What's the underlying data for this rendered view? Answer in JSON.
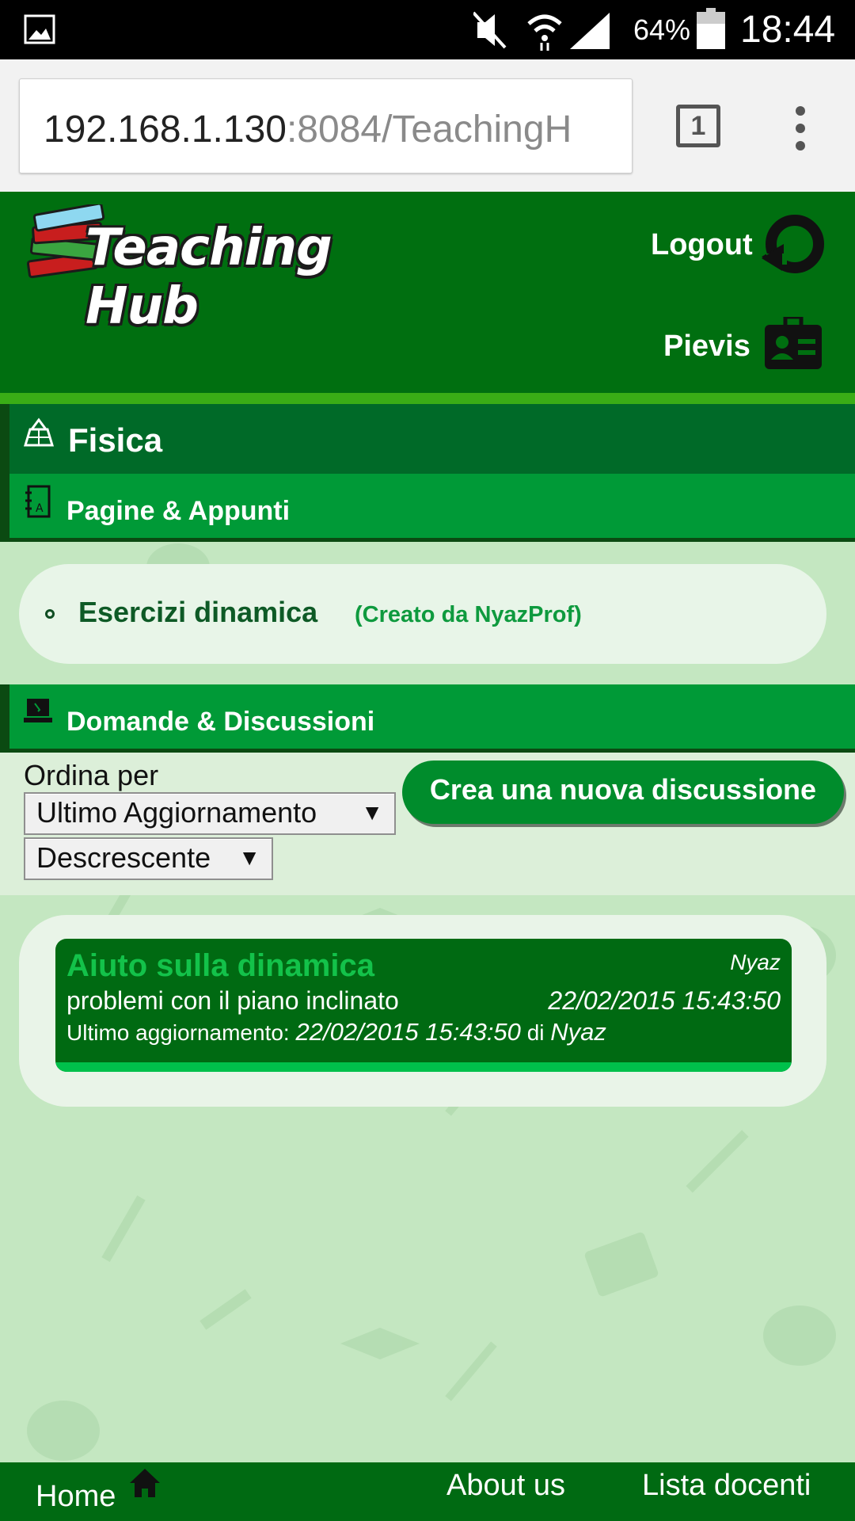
{
  "status_bar": {
    "battery_percent": "64%",
    "time": "18:44"
  },
  "browser": {
    "url_host": "192.168.1.130",
    "url_rest": ":8084/TeachingH",
    "tab_count": "1"
  },
  "header": {
    "logo_text": "Teaching Hub",
    "logout_label": "Logout",
    "user_name": "Pievis"
  },
  "subject": {
    "title": "Fisica"
  },
  "pages": {
    "section_title": "Pagine & Appunti",
    "items": [
      {
        "name": "Esercizi dinamica",
        "creator": "(Creato da NyazProf)"
      }
    ]
  },
  "discussions": {
    "section_title": "Domande & Discussioni",
    "sort_label": "Ordina per",
    "sort_field": "Ultimo Aggiornamento",
    "sort_order": "Descrescente",
    "create_button": "Crea una nuova discussione",
    "items": [
      {
        "title": "Aiuto sulla dinamica",
        "author": "Nyaz",
        "subtitle": "problemi con il piano inclinato",
        "created": "22/02/2015 15:43:50",
        "updated_label": "Ultimo aggiornamento:",
        "updated_date": "22/02/2015 15:43:50",
        "by_label": "di",
        "updated_by": "Nyaz"
      }
    ]
  },
  "footer": {
    "home": "Home",
    "about": "About us",
    "docenti": "Lista docenti"
  },
  "colors": {
    "header_green": "#006f10",
    "section_green": "#009a37",
    "subject_green": "#006a28",
    "background": "#c4e7c1",
    "accent_green": "#13c24a"
  }
}
